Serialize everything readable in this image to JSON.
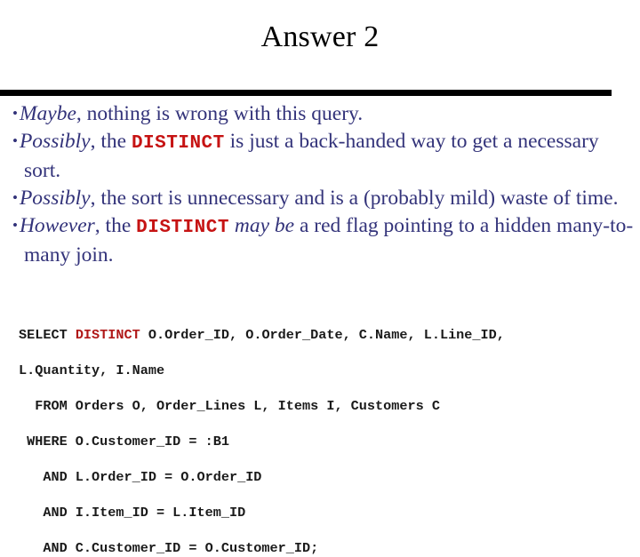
{
  "slide": {
    "title": "Answer 2",
    "accent_blue": "#33337a",
    "keyword_red": "#c61313",
    "sql_red": "#b01818",
    "rule_color": "#000000",
    "background": "#ffffff",
    "bullet_glyph": "•"
  },
  "bullets": [
    {
      "id": "bullet-maybe",
      "segments": [
        {
          "type": "italic",
          "text": "Maybe"
        },
        {
          "type": "plain",
          "text": ", nothing is wrong with this query."
        }
      ],
      "plain_text": "Maybe, nothing is wrong with this query."
    },
    {
      "id": "bullet-possibly-back-handed",
      "segments": [
        {
          "type": "italic",
          "text": "Possibly"
        },
        {
          "type": "plain",
          "text": ", the "
        },
        {
          "type": "keyword",
          "text": "DISTINCT"
        },
        {
          "type": "plain",
          "text": " is just a back-handed way to get a necessary sort."
        }
      ],
      "plain_text": "Possibly, the DISTINCT is just a back-handed way to get a necessary sort."
    },
    {
      "id": "bullet-possibly-unnecessary",
      "segments": [
        {
          "type": "italic",
          "text": "Possibly"
        },
        {
          "type": "plain",
          "text": ", the sort is unnecessary and is a (probably mild) waste of time."
        }
      ],
      "plain_text": "Possibly, the sort is unnecessary and is a (probably mild) waste of time."
    },
    {
      "id": "bullet-however-red-flag",
      "segments": [
        {
          "type": "italic",
          "text": "However"
        },
        {
          "type": "plain",
          "text": ", the "
        },
        {
          "type": "keyword",
          "text": "DISTINCT"
        },
        {
          "type": "plain",
          "text": " "
        },
        {
          "type": "italic",
          "text": "may be"
        },
        {
          "type": "plain",
          "text": " a red flag pointing to a hidden many-to-many join."
        }
      ],
      "plain_text": "However, the DISTINCT may be a red flag pointing to a hidden many-to-many join."
    }
  ],
  "sql": {
    "lines": [
      [
        {
          "type": "plain",
          "text": "SELECT "
        },
        {
          "type": "keyword",
          "text": "DISTINCT"
        },
        {
          "type": "plain",
          "text": " O.Order_ID, O.Order_Date, C.Name, L.Line_ID,"
        }
      ],
      [
        {
          "type": "plain",
          "text": "L.Quantity, I.Name"
        }
      ],
      [
        {
          "type": "plain",
          "text": "  FROM Orders O, Order_Lines L, Items I, Customers C"
        }
      ],
      [
        {
          "type": "plain",
          "text": " WHERE O.Customer_ID = :B1"
        }
      ],
      [
        {
          "type": "plain",
          "text": "   AND L.Order_ID = O.Order_ID"
        }
      ],
      [
        {
          "type": "plain",
          "text": "   AND I.Item_ID = L.Item_ID"
        }
      ],
      [
        {
          "type": "plain",
          "text": "   AND C.Customer_ID = O.Customer_ID;"
        }
      ]
    ],
    "plain_text": "SELECT DISTINCT O.Order_ID, O.Order_Date, C.Name, L.Line_ID,\nL.Quantity, I.Name\n  FROM Orders O, Order_Lines L, Items I, Customers C\n WHERE O.Customer_ID = :B1\n   AND L.Order_ID = O.Order_ID\n   AND I.Item_ID = L.Item_ID\n   AND C.Customer_ID = O.Customer_ID;"
  }
}
